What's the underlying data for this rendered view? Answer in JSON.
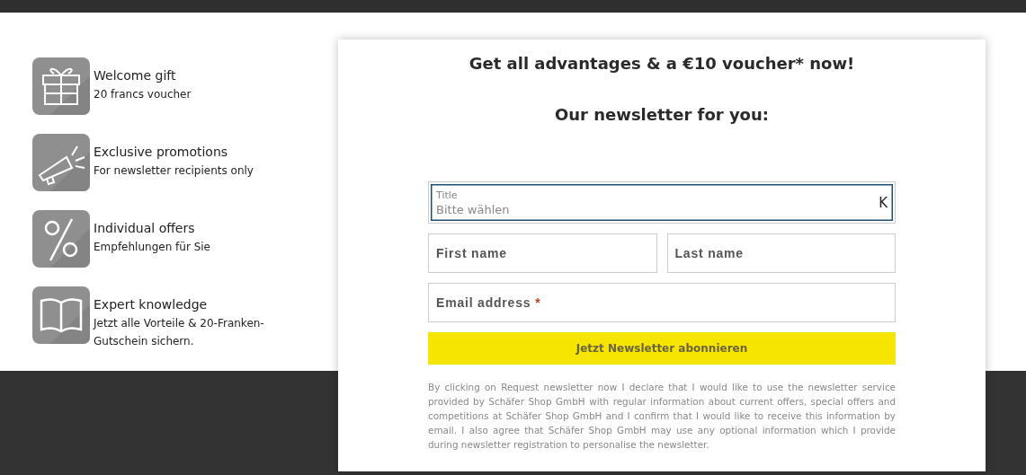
{
  "benefits": [
    {
      "title": "Welcome gift",
      "text": "20 francs voucher"
    },
    {
      "title": "Exclusive promotions",
      "text": "For newsletter recipients only"
    },
    {
      "title": "Individual offers",
      "text": "Empfehlungen für Sie"
    },
    {
      "title": "Expert knowledge",
      "text": "Jetzt alle Vorteile & 20-Franken-Gutschein sichern."
    }
  ],
  "signup": {
    "heading": "Get all advantages & a €10 voucher* now!",
    "subheading": "Our newsletter for you:",
    "title_select": {
      "label": "Title",
      "value": "Bitte wählen",
      "glyph": "K",
      "focused": true
    },
    "first_name": {
      "placeholder": "First name"
    },
    "last_name": {
      "placeholder": "Last name"
    },
    "email": {
      "placeholder": "Email address",
      "required_mark": "*"
    },
    "submit": "Jetzt Newsletter abonnieren",
    "disclaimer": "By clicking on Request newsletter now I declare that I would like to use the newsletter service provided by Schäfer Shop GmbH with regular information about current offers, special offers and competitions at Schäfer Shop GmbH and I confirm that I would like to receive this information by email. I also agree that Schäfer Shop GmbH may use any optional information which I provide during newsletter registration to personalise the newsletter."
  }
}
